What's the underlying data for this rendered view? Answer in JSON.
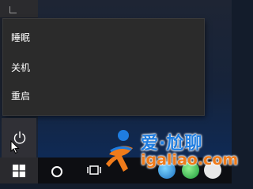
{
  "power_menu": {
    "items": [
      {
        "label": "睡眠"
      },
      {
        "label": "关机"
      },
      {
        "label": "重启"
      }
    ]
  },
  "start_menu": {
    "power_icon": "power-icon",
    "start_icon": "windows-logo-icon"
  },
  "taskbar": {
    "icons": [
      "windows-logo-icon",
      "cortana-circle-icon",
      "task-view-icon"
    ]
  },
  "watermark": {
    "title": "爱·尬聊",
    "domain": "igaliao.com"
  },
  "colors": {
    "menu_bg": "#2b2b2b",
    "menu_text": "#ffffff",
    "taskbar_bg": "#0d0e12",
    "watermark_blue": "#1f7de0",
    "watermark_orange": "#f07b1a"
  }
}
